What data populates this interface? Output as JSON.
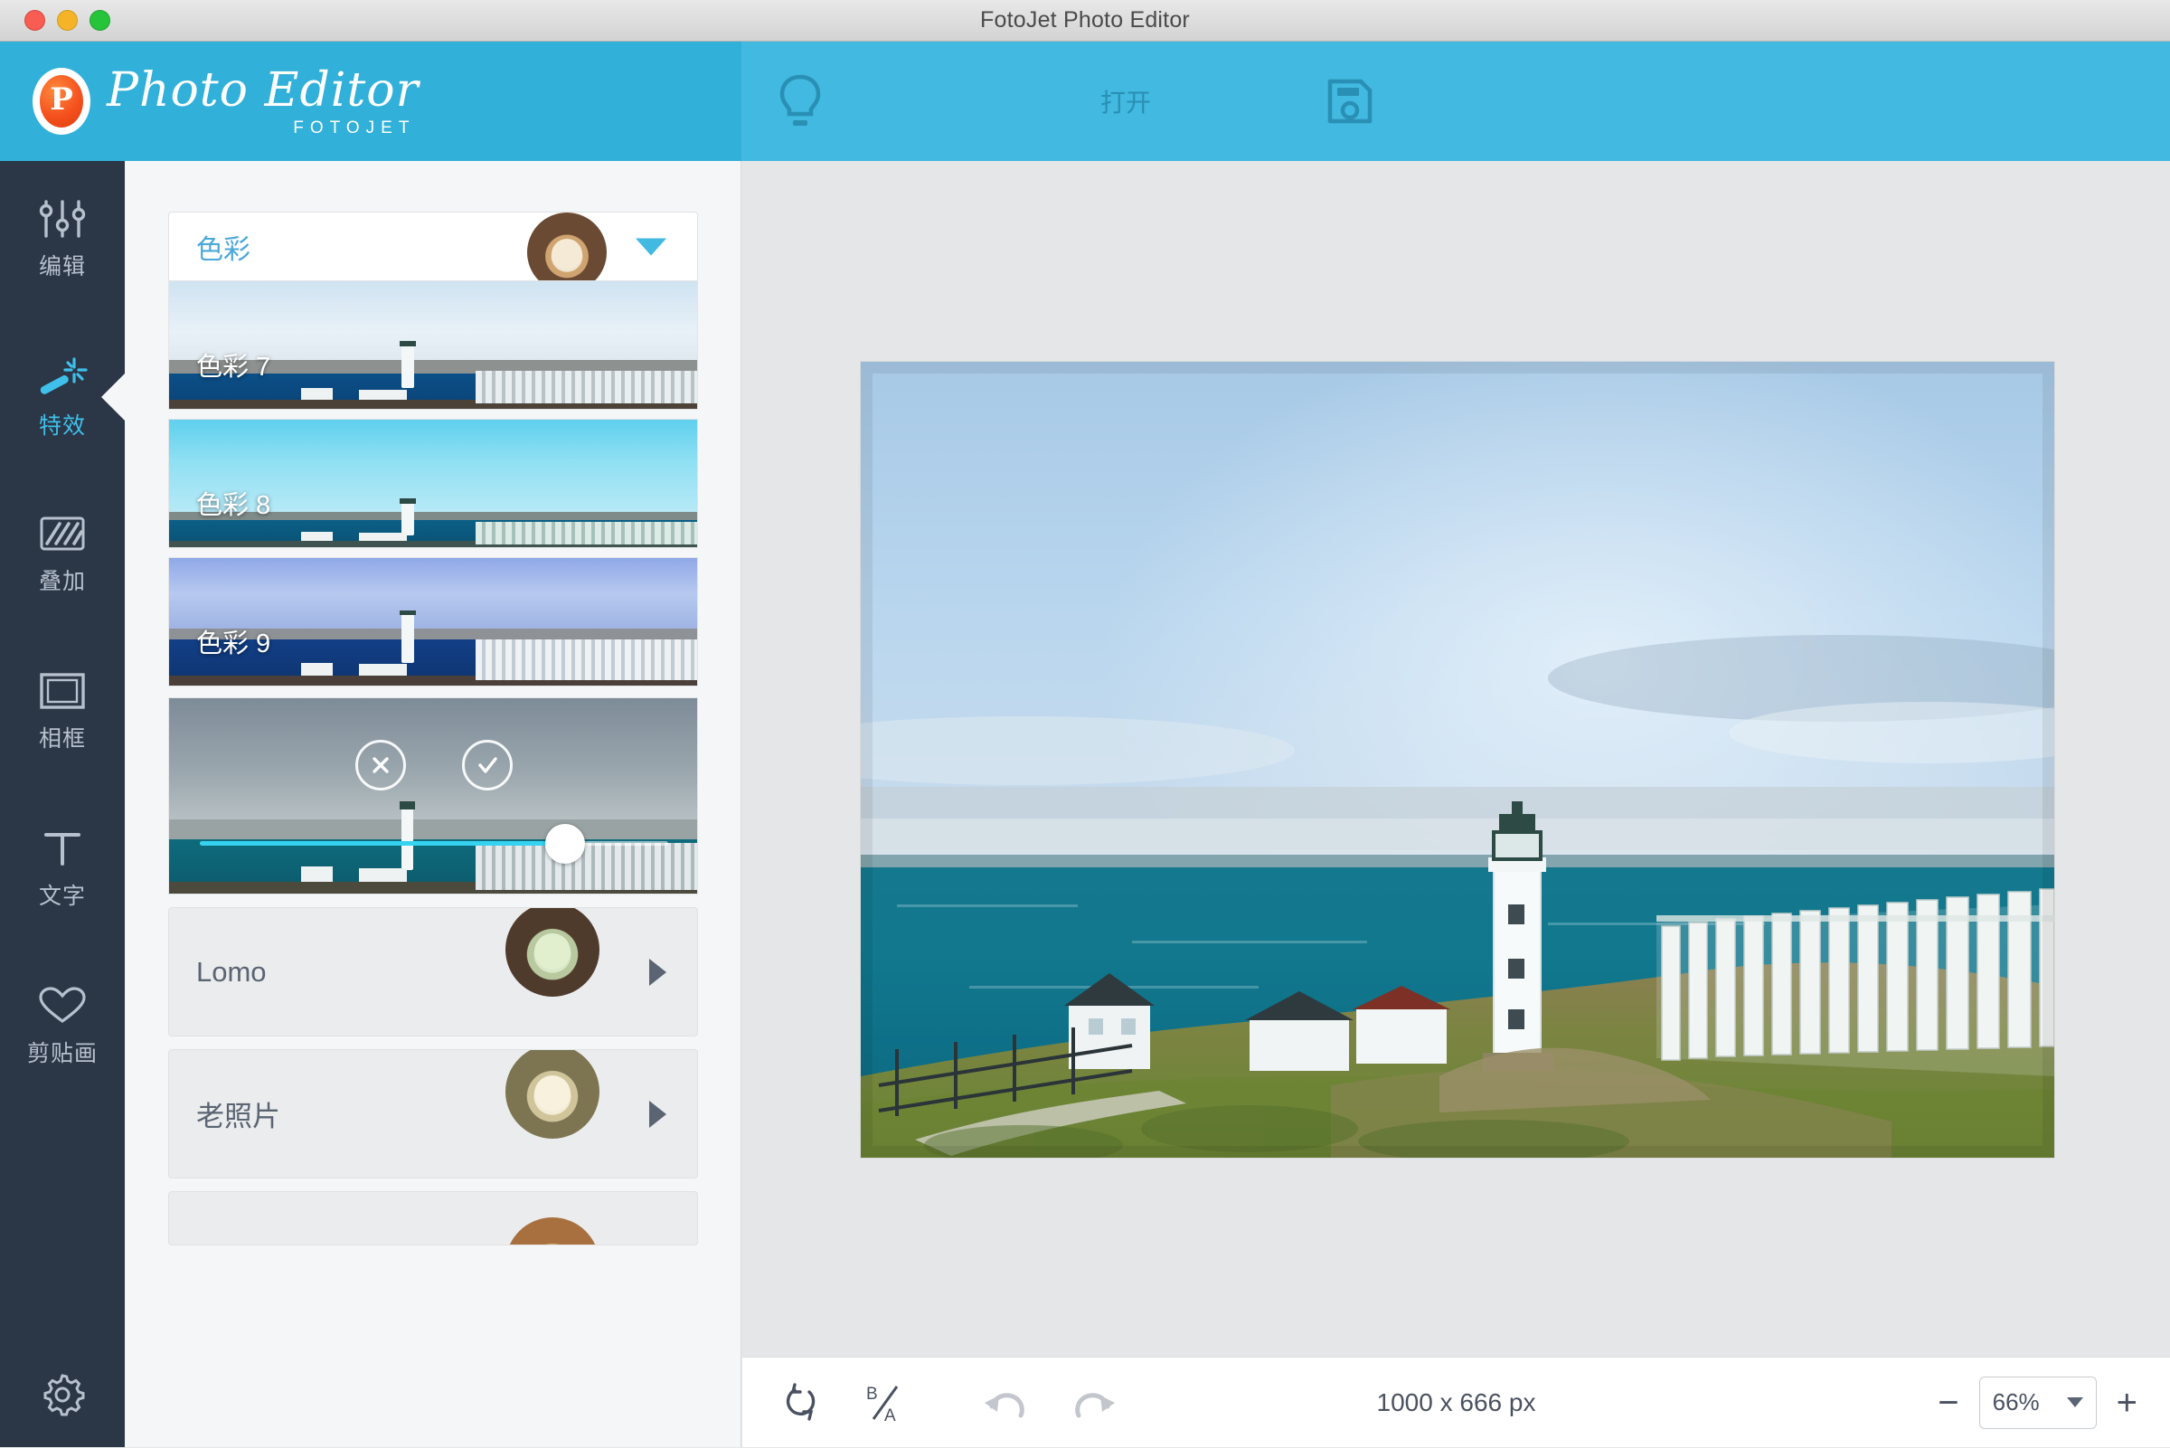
{
  "window": {
    "title": "FotoJet Photo Editor",
    "traffic_lights": [
      "close",
      "minimize",
      "zoom"
    ]
  },
  "brand": {
    "logo_mark": "p-logo-icon",
    "name": "Photo Editor",
    "subtitle": "FOTOJET"
  },
  "toolbar": {
    "tips_icon": "lightbulb-icon",
    "open_label": "打开",
    "save_icon": "floppy-disk-icon"
  },
  "sidebar": {
    "items": [
      {
        "label": "编辑",
        "icon": "sliders-icon",
        "active": false
      },
      {
        "label": "特效",
        "icon": "magic-wand-icon",
        "active": true
      },
      {
        "label": "叠加",
        "icon": "diagonal-stripes-icon",
        "active": false
      },
      {
        "label": "相框",
        "icon": "frame-icon",
        "active": false
      },
      {
        "label": "文字",
        "icon": "text-t-icon",
        "active": false
      },
      {
        "label": "剪贴画",
        "icon": "heart-icon",
        "active": false
      }
    ],
    "settings": {
      "label": "",
      "icon": "gear-icon"
    }
  },
  "panel": {
    "category_header": {
      "name": "色彩",
      "thumb": "coffee-thumb-icon",
      "caret": "chevron-down-icon"
    },
    "filters": [
      {
        "name": "色彩 7",
        "selected": true
      },
      {
        "name": "色彩 8",
        "selected": false
      },
      {
        "name": "色彩 9",
        "selected": false
      }
    ],
    "adjust": {
      "cancel_icon": "close-x-icon",
      "confirm_icon": "check-icon",
      "slider_value": 78,
      "slider_min": 0,
      "slider_max": 100
    },
    "categories": [
      {
        "name": "Lomo",
        "thumb": "coffee-thumb-icon",
        "arrow": "play-arrow-icon"
      },
      {
        "name": "老照片",
        "thumb": "coffee-thumb-icon",
        "arrow": "play-arrow-icon"
      }
    ]
  },
  "canvas": {
    "image_alt": "lighthouse-coastal-photo"
  },
  "bottombar": {
    "reset_icon": "rotate-reset-icon",
    "compare_icon": "before-after-icon",
    "undo_icon": "undo-icon",
    "redo_icon": "redo-icon",
    "dimensions": "1000 x 666 px",
    "zoom_out": "−",
    "zoom_value": "66%",
    "zoom_caret": "chevron-down-icon",
    "zoom_in": "+"
  },
  "colors": {
    "brand_blue": "#31b0d9",
    "toolbar_blue": "#41b9e0",
    "sidebar_dark": "#2b3647",
    "active_cyan": "#3fc0ea",
    "panel_bg": "#f5f6f7",
    "workspace_bg": "#e5e6e7"
  }
}
